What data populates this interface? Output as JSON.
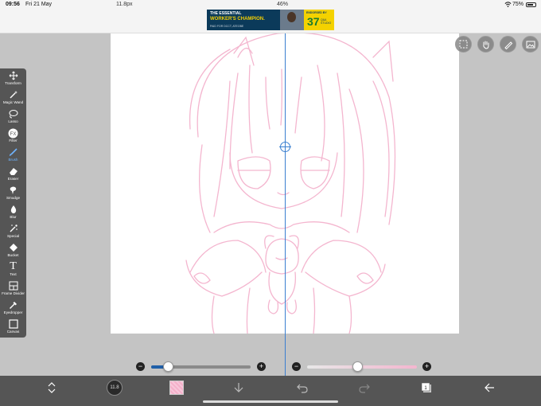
{
  "status_bar": {
    "time": "09:56",
    "date": "Fri 21 May",
    "battery": "75%"
  },
  "ad": {
    "line1": "THE ESSENTIAL",
    "line2": "WORKER'S CHAMPION.",
    "line3": "PAID FOR DCCT, ATEOBE",
    "badge_header": "ENDORSED BY",
    "badge_number": "37",
    "badge_sub": "Q&A STUDIO"
  },
  "toolbar": {
    "active_tool": "Brush",
    "tools": [
      {
        "label": "Transform",
        "icon": "transform-icon"
      },
      {
        "label": "Magic Wand",
        "icon": "magic-wand-icon"
      },
      {
        "label": "Lasso",
        "icon": "lasso-icon"
      },
      {
        "label": "Filter",
        "icon": "filter-fx-icon"
      },
      {
        "label": "Brush",
        "icon": "brush-icon"
      },
      {
        "label": "Eraser",
        "icon": "eraser-icon"
      },
      {
        "label": "Smudge",
        "icon": "smudge-icon"
      },
      {
        "label": "Blur",
        "icon": "blur-drop-icon"
      },
      {
        "label": "Special",
        "icon": "special-wand-icon"
      },
      {
        "label": "Bucket",
        "icon": "bucket-icon"
      },
      {
        "label": "Text",
        "icon": "text-icon"
      },
      {
        "label": "Frame Divider",
        "icon": "frame-divider-icon"
      },
      {
        "label": "Eyedropper",
        "icon": "eyedropper-icon"
      },
      {
        "label": "Canvas",
        "icon": "canvas-icon"
      }
    ]
  },
  "brush_size": {
    "label": "11.8px",
    "fraction": 0.17
  },
  "opacity": {
    "label": "46%",
    "fraction": 0.46
  },
  "bottom_bar": {
    "brush_preview_label": "11.8"
  },
  "colors": {
    "toolbar_bg": "#555555",
    "accent_blue": "#3a7fd0",
    "sketch_pink": "#f4b6cf"
  }
}
